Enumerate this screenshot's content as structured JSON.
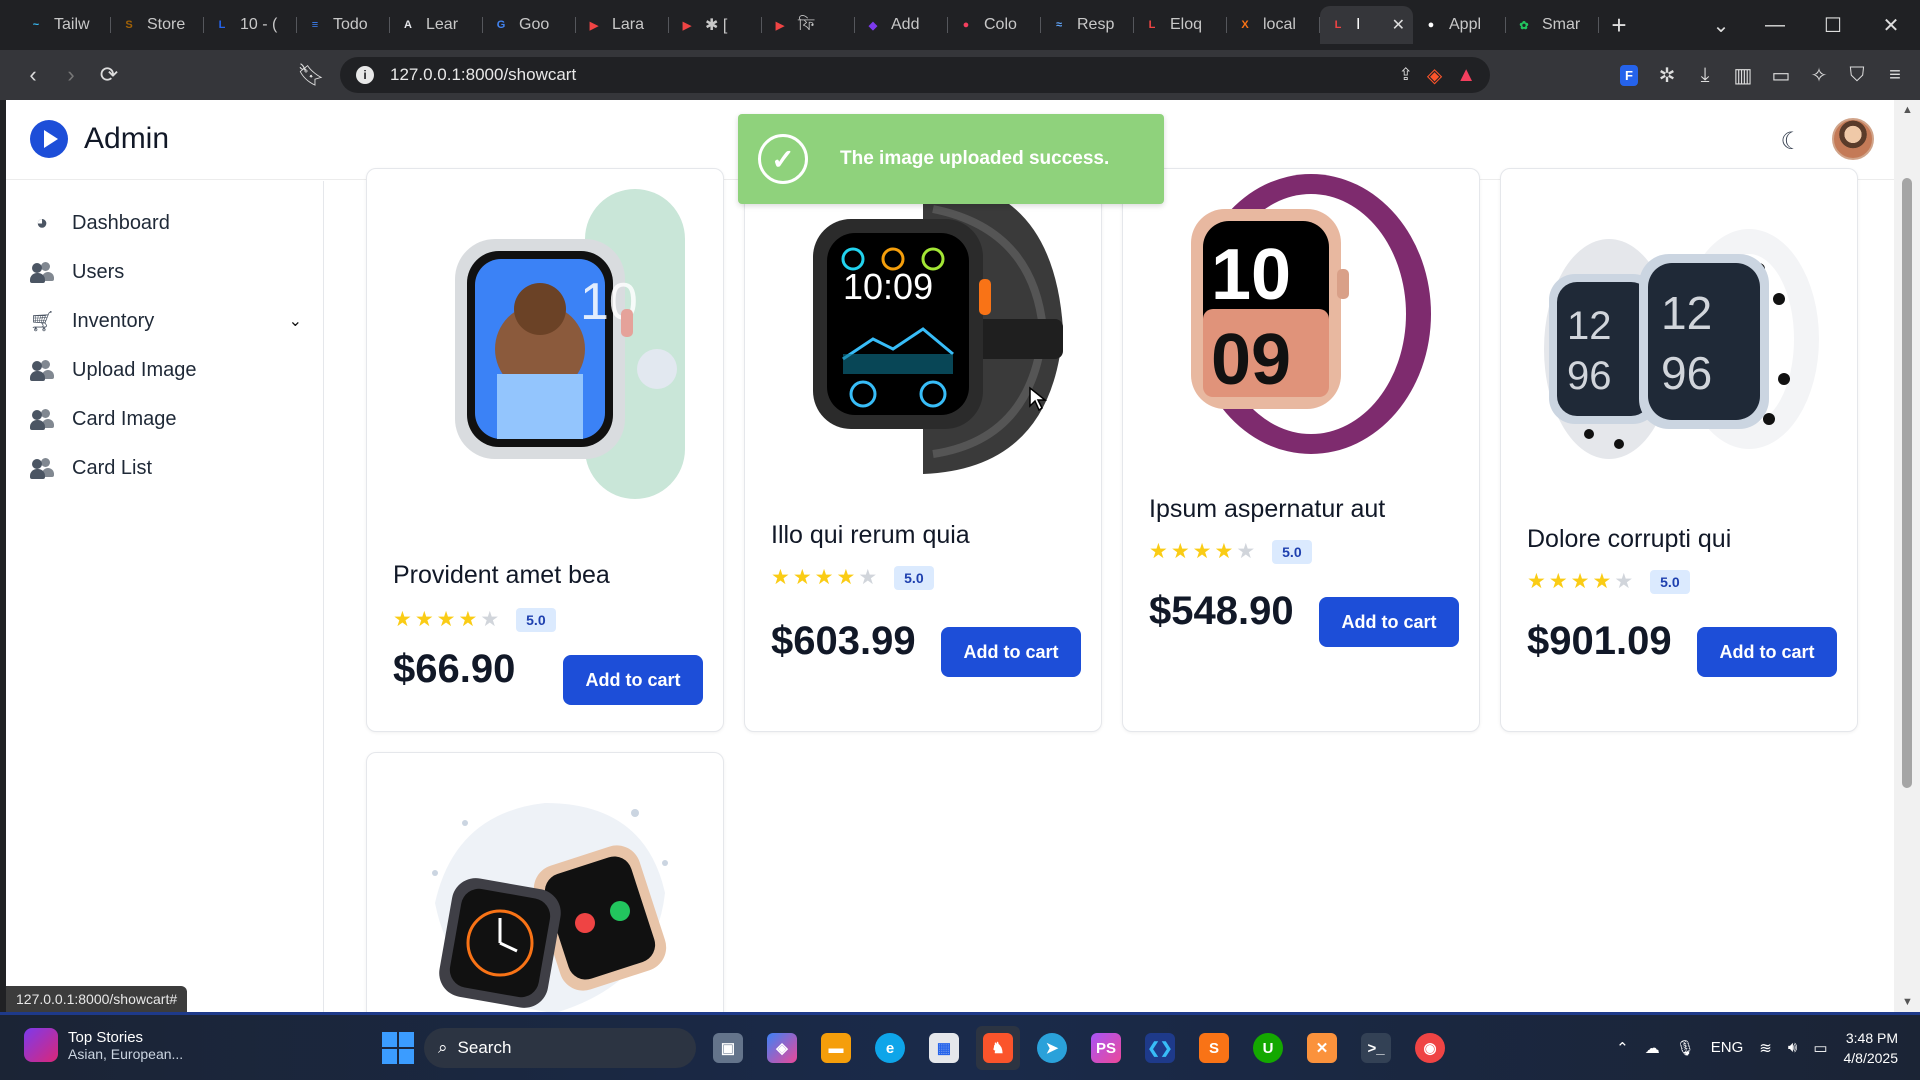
{
  "browser": {
    "tabs": [
      {
        "label": "Tailw",
        "icon": "tailwind-icon",
        "color": "#38bdf8",
        "glyph": "~"
      },
      {
        "label": "Store",
        "icon": "store-icon",
        "color": "#a16207",
        "glyph": "S"
      },
      {
        "label": "10 - (",
        "icon": "doc-icon",
        "color": "#2563eb",
        "glyph": "L"
      },
      {
        "label": "Todo",
        "icon": "todo-icon",
        "color": "#3b82f6",
        "glyph": "≡"
      },
      {
        "label": "Lear",
        "icon": "learn-icon",
        "color": "#e5e7eb",
        "glyph": "A"
      },
      {
        "label": "Goo",
        "icon": "google-translate-icon",
        "color": "#4285f4",
        "glyph": "G"
      },
      {
        "label": "Lara",
        "icon": "youtube-icon",
        "color": "#ef4444",
        "glyph": "▶"
      },
      {
        "label": "✱ [",
        "icon": "youtube-icon",
        "color": "#ef4444",
        "glyph": "▶"
      },
      {
        "label": "ফি",
        "icon": "youtube-icon",
        "color": "#ef4444",
        "glyph": "▶"
      },
      {
        "label": "Add",
        "icon": "shield-icon",
        "color": "#7c3aed",
        "glyph": "◆"
      },
      {
        "label": "Colo",
        "icon": "color-icon",
        "color": "#f43f5e",
        "glyph": "●"
      },
      {
        "label": "Resp",
        "icon": "wave-icon",
        "color": "#60a5fa",
        "glyph": "≈"
      },
      {
        "label": "Eloq",
        "icon": "laravel-icon",
        "color": "#ef4444",
        "glyph": "L"
      },
      {
        "label": "local",
        "icon": "xampp-icon",
        "color": "#f97316",
        "glyph": "X"
      },
      {
        "label": "I",
        "icon": "laravel-icon",
        "color": "#ef4444",
        "glyph": "L",
        "active": true
      },
      {
        "label": "Appl",
        "icon": "apple-icon",
        "color": "#ffffff",
        "glyph": "●"
      },
      {
        "label": "Smar",
        "icon": "leaf-icon",
        "color": "#22c55e",
        "glyph": "✿"
      }
    ],
    "new_tab": "+",
    "url": "127.0.0.1:8000/showcart"
  },
  "app": {
    "brand": "Admin",
    "nav": [
      {
        "label": "Dashboard",
        "icon": "pie-chart-icon"
      },
      {
        "label": "Users",
        "icon": "users-icon"
      },
      {
        "label": "Inventory",
        "icon": "cart-icon",
        "has_submenu": true
      },
      {
        "label": "Upload Image",
        "icon": "users-icon"
      },
      {
        "label": "Card Image",
        "icon": "users-icon"
      },
      {
        "label": "Card List",
        "icon": "users-icon"
      }
    ]
  },
  "toast": {
    "message": "The image uploaded success.",
    "color": "#8fd27c"
  },
  "products": [
    {
      "title": "Provident amet bea",
      "rating_badge": "5.0",
      "stars": 4,
      "price": "$66.90",
      "button": "Add to cart",
      "image": "watch-green-band"
    },
    {
      "title": "Illo qui rerum quia",
      "rating_badge": "5.0",
      "stars": 4,
      "price": "$603.99",
      "button": "Add to cart",
      "image": "watch-ultra-milanese"
    },
    {
      "title": "Ipsum aspernatur aut",
      "rating_badge": "5.0",
      "stars": 4,
      "price": "$548.90",
      "button": "Add to cart",
      "image": "watch-purple-loop"
    },
    {
      "title": "Dolore corrupti qui",
      "rating_badge": "5.0",
      "stars": 4,
      "price": "$901.09",
      "button": "Add to cart",
      "image": "watch-nike-pair"
    },
    {
      "title": "",
      "rating_badge": "",
      "stars": 0,
      "price": "",
      "button": "",
      "image": "watch-splash-pair"
    }
  ],
  "status_url": "127.0.0.1:8000/showcart#",
  "taskbar": {
    "news_title": "Top Stories",
    "news_sub": "Asian, European...",
    "search": "Search",
    "lang": "ENG",
    "time": "3:48 PM",
    "date": "4/8/2025"
  },
  "colors": {
    "primary_button": "#1d4ed8",
    "star": "#facc15",
    "badge_bg": "#dbeafe"
  }
}
